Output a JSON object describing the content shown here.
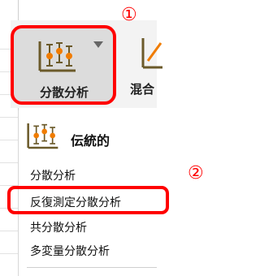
{
  "annotations": {
    "marker_1": "①",
    "marker_2": "②"
  },
  "ribbon": {
    "button": {
      "label": "分散分析",
      "icon": "variance-chart-icon",
      "dropdown_icon": "dropdown-caret-icon"
    },
    "next_button": {
      "label": "混合",
      "icon": "mixed-model-icon"
    }
  },
  "menu": {
    "header": {
      "label": "伝統的",
      "icon": "variance-chart-icon"
    },
    "items": [
      {
        "label": "分散分析"
      },
      {
        "label": "反復測定分散分析",
        "highlighted": true
      },
      {
        "label": "共分散分析"
      },
      {
        "label": "多変量分散分析"
      }
    ]
  },
  "colors": {
    "annotation": "#ff0000",
    "chart_orange": "#f07c00",
    "chart_dark": "#6b5a2a"
  }
}
